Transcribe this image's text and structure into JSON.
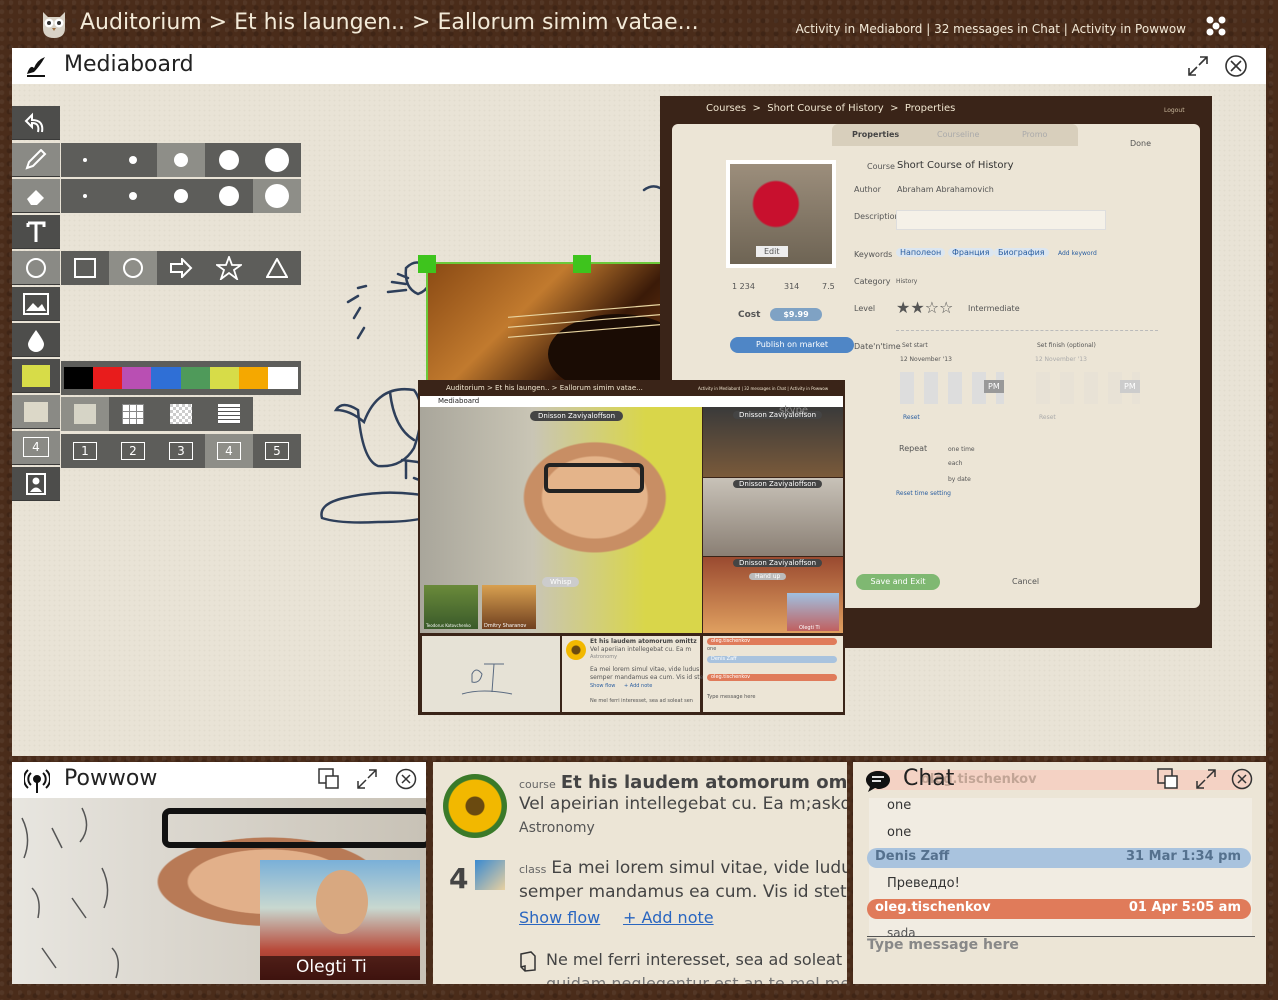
{
  "topbar": {
    "breadcrumb": "Auditorium > Et his laungen.. > Eallorum  simim vatae...",
    "activity": "Activity in Mediabord | 32 messages in Chat | Activity in Powwow"
  },
  "mediaboard": {
    "title": "Mediaboard",
    "toolbar": {
      "page_number": "4",
      "pages": [
        "1",
        "2",
        "3",
        "4",
        "5"
      ],
      "colors": [
        "#000000",
        "#e81c1c",
        "#b94fb3",
        "#2f6fd6",
        "#4f9a5a",
        "#d7dc48",
        "#f5a800",
        "#ffffff"
      ],
      "current_color": "#d7dc48"
    }
  },
  "properties": {
    "breadcrumb_1": "Courses",
    "breadcrumb_2": "Short Course of History",
    "breadcrumb_3": "Properties",
    "logout": "Logout",
    "tabs": [
      "Properties",
      "Courseline",
      "Promo"
    ],
    "done": "Done",
    "edit": "Edit",
    "course_label": "Course",
    "course_value": "Short Course of History",
    "author_label": "Author",
    "author_value": "Abraham Abrahamovich",
    "description_label": "Description",
    "keywords_label": "Keywords",
    "keywords": [
      "Наполеон",
      "Франция",
      "Биография"
    ],
    "add_keyword": "Add keyword",
    "category_label": "Category",
    "category_value": "History",
    "level_label": "Level",
    "level_value": "Intermediate",
    "level_stars": 2,
    "views": "1 234",
    "members": "314",
    "rating": "7.5",
    "cost_label": "Cost",
    "cost_value": "$9.99",
    "publish": "Publish on market",
    "datetime_label": "Date'n'time",
    "set_start": "Set start",
    "set_finish": "Set finish (optional)",
    "start_date": "12  November '13",
    "finish_date": "12  November '13",
    "ampm": "PM",
    "reset": "Reset",
    "repeat_label": "Repeat",
    "repeat_options": [
      "one time",
      "each",
      "by date"
    ],
    "reset_time": "Reset time setting",
    "save": "Save and Exit",
    "cancel": "Cancel"
  },
  "nested": {
    "breadcrumb": "Auditorium > Et his laungen.. > Eallorum  simim vatae...",
    "activity": "Activity in Mediabord | 32 messages in Chat | Activity in Powwow",
    "title": "Mediaboard",
    "main_name": "Dnisson Zaviyaloffson",
    "whisp": "Whisp",
    "side_names": [
      "Dnisson Zaviyaloffson",
      "Dnisson Zaviyaloffson",
      "Dnisson Zaviyaloffson"
    ],
    "hand_up": "Hand up",
    "thumb_names": [
      "Teodorus Kotovchenko",
      "Dmitry Sharanov"
    ],
    "thumb_right": "Olegti Ti",
    "skype": "skype",
    "course_line1": "Et his laudem atomorum omittz",
    "course_line2": "Vel aperiian intellegebat cu. Ea m",
    "course_subject": "Astronomy",
    "class_line1": "Ea mei lorem simul vitae, vide ludus",
    "class_line2": "semper mandamus ea cum. Vis id ste",
    "show_flow": "Show flow",
    "add_note": "+ Add note",
    "note_text": "Ne mel ferri interesset, sea ad soleat sen",
    "chat_user1": "oleg.tischenkov",
    "chat_time1": "31 Mar 1:34 pm",
    "chat_user2": "Denis Zaff",
    "chat_time2": "31 Mar 1:34 pm",
    "chat_user3": "oleg.tischenkov",
    "chat_time3": "01 Apr 5:05 am",
    "chat_one": "one",
    "type_here": "Type message here"
  },
  "powwow": {
    "title": "Powwow",
    "pip_name": "Olegti Ti"
  },
  "course": {
    "course_tag": "course",
    "course_title": "Et his laudem atomorum omitta",
    "course_desc": "Vel apeirian intellegebat cu. Ea m;askdc",
    "subject": "Astronomy",
    "class_num": "4",
    "class_tag": "class",
    "class_line1": "Ea mei lorem simul vitae, vide ludus",
    "class_line2": "semper mandamus ea cum. Vis id stet r",
    "show_flow": "Show flow",
    "add_note": "+ Add note",
    "note_line1": "Ne mel ferri interesset, sea ad soleat sen",
    "note_line2": "quidam neglegentur est an te mel meis"
  },
  "chat": {
    "title": "Chat",
    "partial_user": "oleg.tischenkov",
    "lines": [
      "one",
      "one"
    ],
    "msg1_user": "Denis Zaff",
    "msg1_time": "31 Mar 1:34 pm",
    "msg1_text": "Преведдо!",
    "msg2_user": "oleg.tischenkov",
    "msg2_time": "01 Apr 5:05 am",
    "msg2_text": "sada",
    "input_placeholder": "Type message here"
  }
}
